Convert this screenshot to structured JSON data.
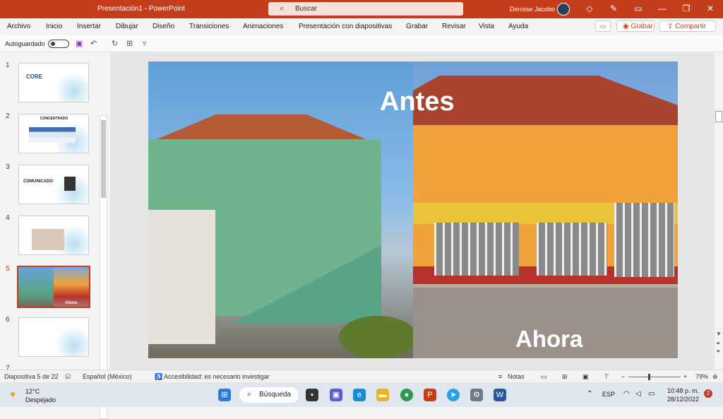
{
  "window": {
    "title": "Presentación1  -  PowerPoint",
    "search_placeholder": "Buscar",
    "user": "Denisse Jacobo"
  },
  "menu": {
    "items": [
      "Archivo",
      "Inicio",
      "Insertar",
      "Dibujar",
      "Diseño",
      "Transiciones",
      "Animaciones",
      "Presentación con diapositivas",
      "Grabar",
      "Revisar",
      "Vista",
      "Ayuda"
    ],
    "grabar_btn": "Grabar",
    "compartir_btn": "Compartir"
  },
  "qat": {
    "autosave": "Autoguardado"
  },
  "thumbnails": [
    {
      "num": "1",
      "text": "CORE"
    },
    {
      "num": "2",
      "text": "CONCENTRADO"
    },
    {
      "num": "3",
      "text": "COMUNICADO"
    },
    {
      "num": "4",
      "text": ""
    },
    {
      "num": "5",
      "text": "Ahora"
    },
    {
      "num": "6",
      "text": ""
    },
    {
      "num": "7",
      "text": ""
    }
  ],
  "slide": {
    "label_left": "Antes",
    "label_right": "Ahora"
  },
  "status": {
    "slide_count": "Diapositiva 5 de 22",
    "language": "Español (México)",
    "accessibility": "Accesibilidad: es necesario investigar",
    "notes": "Notas",
    "zoom": "79%"
  },
  "taskbar": {
    "temp": "12°C",
    "condition": "Despejado",
    "search": "Búsqueda",
    "lang": "ESP",
    "time": "10:48 p. m.",
    "date": "28/12/2022",
    "notif": "2"
  },
  "colors": {
    "accent": "#c43e1c"
  }
}
